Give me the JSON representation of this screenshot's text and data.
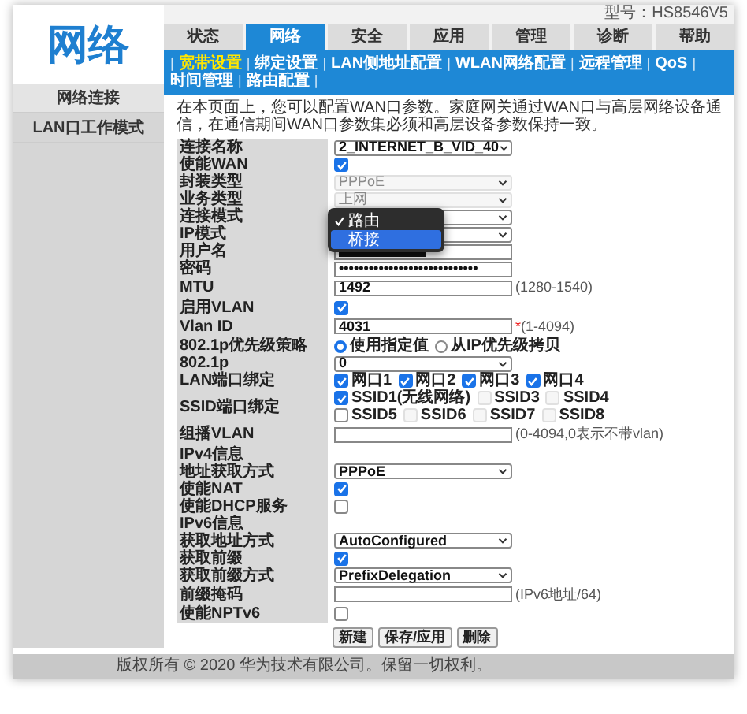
{
  "header": {
    "logo": "网络",
    "model": "型号：HS8546V5"
  },
  "tabs": [
    {
      "label": "状态",
      "selected": false
    },
    {
      "label": "网络",
      "selected": true
    },
    {
      "label": "安全",
      "selected": false
    },
    {
      "label": "应用",
      "selected": false
    },
    {
      "label": "管理",
      "selected": false
    },
    {
      "label": "诊断",
      "selected": false
    },
    {
      "label": "帮助",
      "selected": false
    }
  ],
  "subnav": [
    {
      "label": "宽带设置",
      "selected": true
    },
    {
      "label": "绑定设置",
      "selected": false
    },
    {
      "label": "LAN侧地址配置",
      "selected": false
    },
    {
      "label": "WLAN网络配置",
      "selected": false
    },
    {
      "label": "远程管理",
      "selected": false
    },
    {
      "label": "QoS",
      "selected": false
    },
    {
      "label": "时间管理",
      "selected": false
    },
    {
      "label": "路由配置",
      "selected": false
    }
  ],
  "subnav_separator": "|",
  "sidebar": [
    {
      "label": "网络连接",
      "selected": true
    },
    {
      "label": "LAN口工作模式",
      "selected": false
    }
  ],
  "description": "在本页面上，您可以配置WAN口参数。家庭网关通过WAN口与高层网络设备通信，在通信期间WAN口参数集必须和高层设备参数保持一致。",
  "rows": [
    {
      "kind": "select",
      "label": "连接名称",
      "value": "2_INTERNET_B_VID_40",
      "disabled": false
    },
    {
      "kind": "checkbox",
      "label": "使能WAN",
      "checked": true
    },
    {
      "kind": "select",
      "label": "封装类型",
      "value": "PPPoE",
      "disabled": true
    },
    {
      "kind": "select",
      "label": "业务类型",
      "value": "上网",
      "disabled": true
    },
    {
      "kind": "dropdown",
      "label": "连接模式",
      "options": [
        {
          "label": "路由",
          "checked": true,
          "highlighted": false
        },
        {
          "label": "桥接",
          "checked": false,
          "highlighted": true
        }
      ]
    },
    {
      "kind": "select",
      "label": "IP模式",
      "value": "",
      "disabled": false
    },
    {
      "kind": "redacted",
      "label": "用户名"
    },
    {
      "kind": "text",
      "label": "密码",
      "value": "••••••••••••••••••••••••••••"
    },
    {
      "kind": "text",
      "label": "MTU",
      "value": "1492",
      "hint": "(1280-1540)"
    },
    {
      "kind": "checkbox",
      "label": "启用VLAN",
      "checked": true
    },
    {
      "kind": "text",
      "label": "Vlan ID",
      "value": "4031",
      "required": "*",
      "hint": "(1-4094)"
    },
    {
      "kind": "radio",
      "label": "802.1p优先级策略",
      "options": [
        {
          "label": "使用指定值",
          "selected": true
        },
        {
          "label": "从IP优先级拷贝",
          "selected": false
        }
      ]
    },
    {
      "kind": "select",
      "label": "802.1p",
      "value": "0",
      "disabled": false
    },
    {
      "kind": "checks",
      "label": "LAN端口绑定",
      "lines": [
        [
          {
            "label": "网口1",
            "checked": true,
            "disabled": false
          },
          {
            "label": "网口2",
            "checked": true,
            "disabled": false
          },
          {
            "label": "网口3",
            "checked": true,
            "disabled": false
          },
          {
            "label": "网口4",
            "checked": true,
            "disabled": false
          }
        ]
      ]
    },
    {
      "kind": "checks",
      "label": "SSID端口绑定",
      "lines": [
        [
          {
            "label": "SSID1(无线网络)",
            "checked": true,
            "disabled": false
          },
          {
            "label": "SSID3",
            "checked": false,
            "disabled": true
          },
          {
            "label": "SSID4",
            "checked": false,
            "disabled": true
          }
        ],
        [
          {
            "label": "SSID5",
            "checked": false,
            "disabled": false
          },
          {
            "label": "SSID6",
            "checked": false,
            "disabled": true
          },
          {
            "label": "SSID7",
            "checked": false,
            "disabled": true
          },
          {
            "label": "SSID8",
            "checked": false,
            "disabled": true
          }
        ]
      ]
    },
    {
      "kind": "text",
      "label": "组播VLAN",
      "value": "",
      "hint": "(0-4094,0表示不带vlan)"
    },
    {
      "kind": "section",
      "label": "IPv4信息"
    },
    {
      "kind": "select",
      "label": "地址获取方式",
      "value": "PPPoE",
      "disabled": false
    },
    {
      "kind": "checkbox",
      "label": "使能NAT",
      "checked": true
    },
    {
      "kind": "checkbox",
      "label": "使能DHCP服务",
      "checked": false
    },
    {
      "kind": "section",
      "label": "IPv6信息"
    },
    {
      "kind": "select",
      "label": "获取地址方式",
      "value": "AutoConfigured",
      "disabled": false
    },
    {
      "kind": "checkbox",
      "label": "获取前缀",
      "checked": true
    },
    {
      "kind": "select",
      "label": "获取前缀方式",
      "value": "PrefixDelegation",
      "disabled": false
    },
    {
      "kind": "text",
      "label": "前缀掩码",
      "value": "",
      "hint": "(IPv6地址/64)"
    },
    {
      "kind": "checkbox",
      "label": "使能NPTv6",
      "checked": false
    }
  ],
  "buttons": [
    "新建",
    "保存/应用",
    "删除"
  ],
  "footer": "版权所有 © 2020 华为技术有限公司。保留一切权利。"
}
